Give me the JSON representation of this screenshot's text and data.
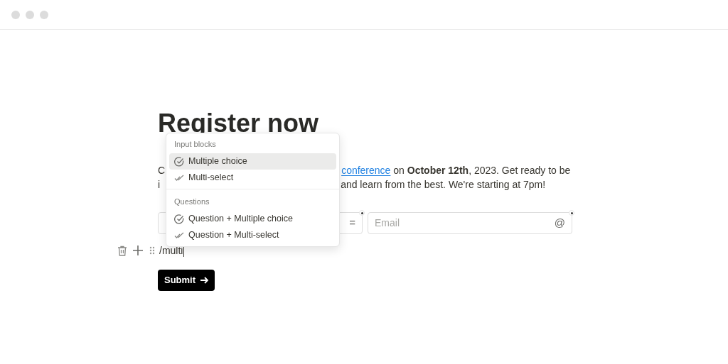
{
  "title": "Register now",
  "paragraph": {
    "line_1_start": "C",
    "line_2_start": "i",
    "line_2_end": "and learn from the best. We're starting at 7pm!"
  },
  "paragraph_link": "conference",
  "paragraph_line_1_rest": " on **October 12th**, 2023. Get ready to be",
  "fields": [
    {
      "icon": "=",
      "required": true
    },
    {
      "placeholder": "Email",
      "icon": "@",
      "required": true
    }
  ],
  "block_input": {
    "value": "/multi"
  },
  "submit_button": {
    "label": "Submit"
  },
  "menu": {
    "sections": [
      {
        "heading": "Input blocks",
        "items": [
          {
            "label": "Multiple choice",
            "kind": "single",
            "selected": true
          },
          {
            "label": "Multi-select",
            "kind": "multi",
            "selected": false
          }
        ]
      },
      {
        "heading": "Questions",
        "items": [
          {
            "label": "Question + Multiple choice",
            "kind": "single",
            "selected": false
          },
          {
            "label": "Question + Multi-select",
            "kind": "multi",
            "selected": false
          }
        ]
      }
    ]
  }
}
